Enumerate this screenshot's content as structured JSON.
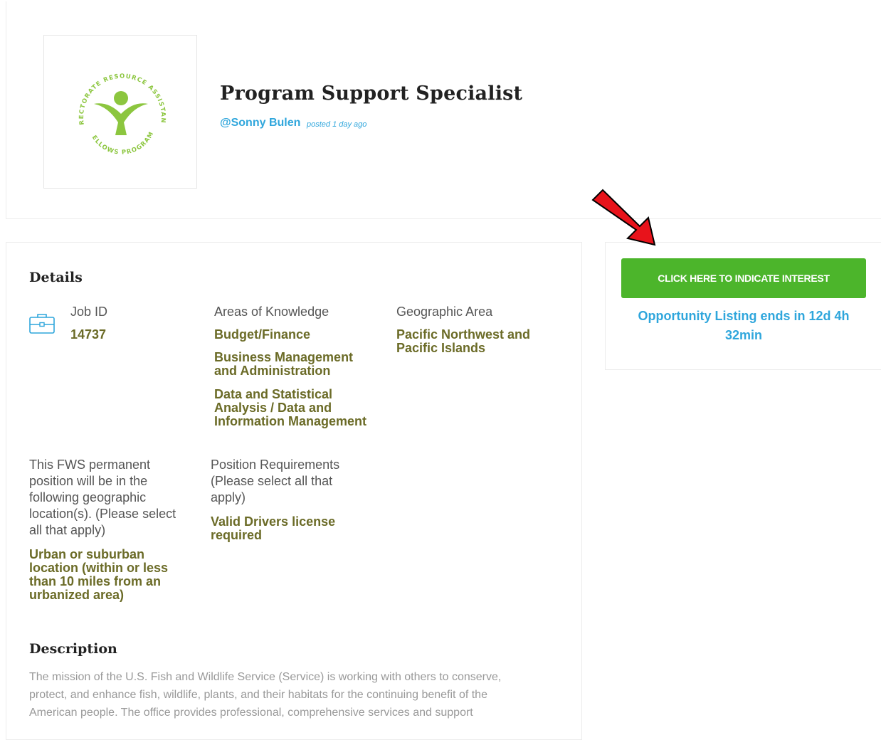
{
  "header": {
    "title": "Program Support Specialist",
    "poster": "@Sonny Bulen",
    "posted": "posted 1 day ago",
    "logo": {
      "text_top": "DIRECTORATE RESOURCE ASSISTANTS",
      "text_bottom": "FELLOWS PROGRAM",
      "color": "#8cc63f"
    }
  },
  "details": {
    "title": "Details",
    "job_id": {
      "label": "Job ID",
      "value": "14737",
      "icon": "briefcase-icon"
    },
    "areas": {
      "label": "Areas of Knowledge",
      "values": [
        [
          "Budget/Finance"
        ],
        [
          "Business Management",
          "and Administration"
        ],
        [
          "Data and Statistical",
          "Analysis / Data and",
          "Information Management"
        ]
      ]
    },
    "geo": {
      "label": "Geographic Area",
      "value": [
        "Pacific Northwest and",
        "Pacific Islands"
      ]
    },
    "location": {
      "label": [
        "This FWS permanent",
        "position will be in the",
        "following geographic",
        "location(s). (Please select",
        "all that apply)"
      ],
      "value": [
        "Urban or suburban",
        "location (within or less",
        "than 10 miles from an",
        "urbanized area)"
      ]
    },
    "requirements": {
      "label": [
        "Position Requirements",
        "(Please select all that",
        "apply)"
      ],
      "value": [
        "Valid Drivers license",
        "required"
      ]
    }
  },
  "description": {
    "title": "Description",
    "lines": [
      "The mission of the U.S. Fish and Wildlife Service (Service) is working with others to conserve,",
      "protect, and enhance fish, wildlife, plants, and their habitats for the continuing benefit of the",
      "American people. The office provides professional, comprehensive services and support"
    ]
  },
  "interest": {
    "button": "CLICK HERE TO INDICATE INTEREST",
    "ends": [
      "Opportunity Listing ends in 12d 4h",
      "32min"
    ]
  },
  "colors": {
    "accent_blue": "#2fa6dc",
    "button_green": "#4cb52b",
    "value_olive": "#6b6b27",
    "arrow_red": "#e8131b"
  }
}
